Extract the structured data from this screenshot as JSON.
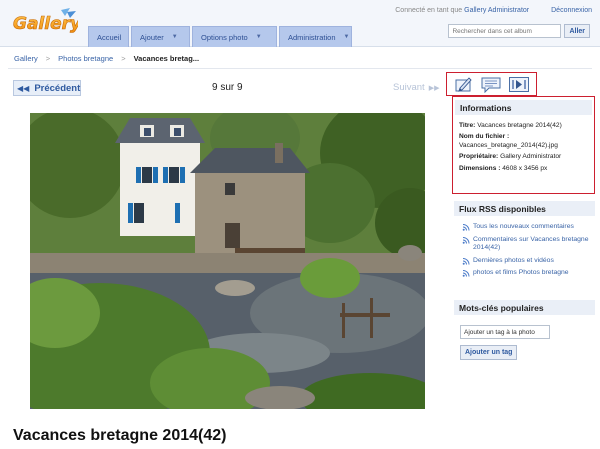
{
  "header": {
    "logo_text": "Gallery",
    "user_prefix": "Connecté en tant que",
    "user_name": "Gallery Administrator",
    "logout": "Déconnexion",
    "search_placeholder": "Rechercher dans cet album",
    "search_button": "Aller"
  },
  "nav": {
    "items": [
      {
        "label": "Accueil"
      },
      {
        "label": "Ajouter"
      },
      {
        "label": "Options photo"
      },
      {
        "label": "Administration"
      }
    ]
  },
  "breadcrumb": {
    "items": [
      "Gallery",
      "Photos bretagne"
    ],
    "separator": ">",
    "current": "Vacances bretag..."
  },
  "photo_nav": {
    "prev_label": "Précédent",
    "prev_arrow": "◀◀",
    "counter": "9 sur 9",
    "next_label": "Suivant",
    "next_arrow": "▶▶"
  },
  "action_icons": [
    "edit-icon",
    "comment-icon",
    "slideshow-icon"
  ],
  "photo": {
    "title": "Vacances bretagne 2014(42)"
  },
  "info": {
    "heading": "Informations",
    "title_label": "Titre:",
    "title_value": "Vacances bretagne 2014(42)",
    "filename_label": "Nom du fichier :",
    "filename_value": "Vacances_bretagne_2014(42).jpg",
    "owner_label": "Propriétaire:",
    "owner_value": "Gallery Administrator",
    "dimensions_label": "Dimensions :",
    "dimensions_value": "4608 x 3456 px"
  },
  "rss": {
    "heading": "Flux RSS disponibles",
    "links": [
      "Tous les nouveaux commentaires",
      "Commentaires sur Vacances bretagne 2014(42)",
      "Dernières photos et vidéos",
      "photos et films Photos bretagne"
    ]
  },
  "tags": {
    "heading": "Mots-clés populaires",
    "input_value": "Ajouter un tag à la photo",
    "button": "Ajouter un tag"
  },
  "colors": {
    "link": "#3a64a7",
    "nav_tab": "#b5c8ec",
    "highlight_border": "#cc1f2f",
    "panel_header": "#eaeff7"
  }
}
